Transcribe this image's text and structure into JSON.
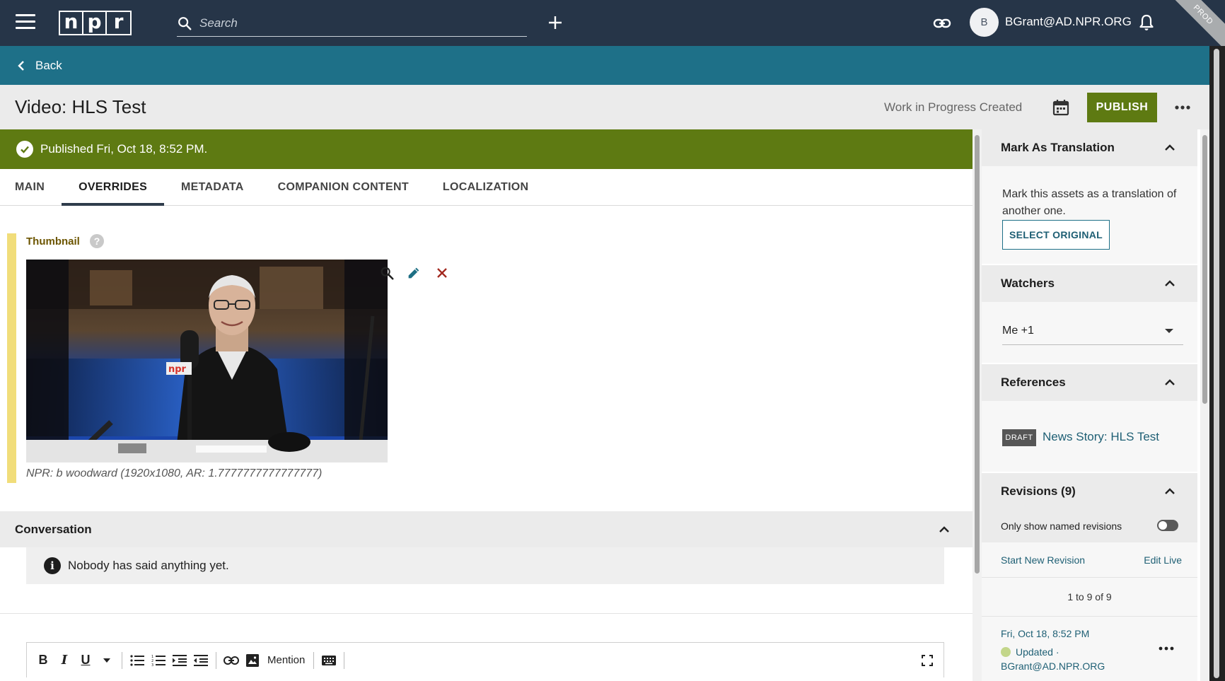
{
  "topbar": {
    "logo_letters": [
      "n",
      "p",
      "r"
    ],
    "search_placeholder": "Search",
    "user_initial": "B",
    "user_name": "BGrant@AD.NPR.ORG",
    "env_ribbon": "PROD"
  },
  "backbar": {
    "back_label": "Back"
  },
  "titlebar": {
    "title": "Video: HLS Test",
    "status": "Work in Progress Created",
    "publish_label": "PUBLISH"
  },
  "banner": {
    "text": "Published Fri, Oct 18, 8:52 PM."
  },
  "tabs": [
    {
      "label": "MAIN",
      "active": false
    },
    {
      "label": "OVERRIDES",
      "active": true
    },
    {
      "label": "METADATA",
      "active": false
    },
    {
      "label": "COMPANION CONTENT",
      "active": false
    },
    {
      "label": "LOCALIZATION",
      "active": false
    }
  ],
  "thumbnail": {
    "label": "Thumbnail",
    "help": "?",
    "caption": "NPR: b woodward (1920x1080, AR: 1.7777777777777777)",
    "mic_flag": "npr"
  },
  "conversation": {
    "title": "Conversation",
    "empty_text": "Nobody has said anything yet."
  },
  "editor": {
    "mention_label": "Mention"
  },
  "sidepanel": {
    "translation": {
      "title": "Mark As Translation",
      "description": "Mark this assets as a translation of another one.",
      "button": "SELECT ORIGINAL"
    },
    "watchers": {
      "title": "Watchers",
      "selected": "Me +1"
    },
    "references": {
      "title": "References",
      "badge": "DRAFT",
      "link": "News Story: HLS Test"
    },
    "revisions": {
      "title": "Revisions (9)",
      "named_only_label": "Only show named revisions",
      "named_only_on": false,
      "start_new": "Start New Revision",
      "edit_live": "Edit Live",
      "count": "1 to 9 of 9",
      "items": [
        {
          "date": "Fri, Oct 18, 8:52 PM",
          "meta": "Updated · BGrant@AD.NPR.ORG"
        }
      ]
    }
  },
  "colors": {
    "topbar": "#263548",
    "backbar": "#1e7088",
    "publish": "#5e7a12",
    "thumbnail_accent": "#f1dd7a"
  }
}
